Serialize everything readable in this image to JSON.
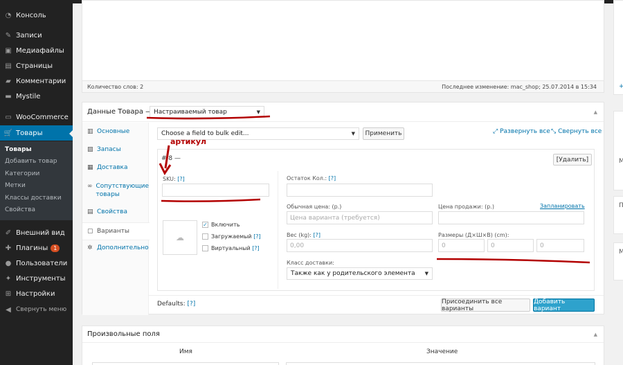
{
  "menu": {
    "items": [
      {
        "label": "Консоль",
        "icon": "dashboard-icon"
      },
      {
        "label": "Записи",
        "icon": "pin-icon"
      },
      {
        "label": "Медиафайлы",
        "icon": "media-icon"
      },
      {
        "label": "Страницы",
        "icon": "pages-icon"
      },
      {
        "label": "Комментарии",
        "icon": "comments-icon"
      },
      {
        "label": "Mystile",
        "icon": "theme-icon"
      },
      {
        "label": "WooCommerce",
        "icon": "woocommerce-icon"
      },
      {
        "label": "Товары",
        "icon": "cart-icon"
      },
      {
        "label": "Внешний вид",
        "icon": "brush-icon"
      },
      {
        "label": "Плагины",
        "icon": "plugin-icon",
        "badge": "1"
      },
      {
        "label": "Пользователи",
        "icon": "users-icon"
      },
      {
        "label": "Инструменты",
        "icon": "wrench-icon"
      },
      {
        "label": "Настройки",
        "icon": "settings-icon"
      },
      {
        "label": "Свернуть меню",
        "icon": "collapse-icon"
      }
    ],
    "submenu": [
      "Товары",
      "Добавить товар",
      "Категории",
      "Метки",
      "Классы доставки",
      "Свойства"
    ]
  },
  "editor": {
    "word_count": "Количество слов: 2",
    "last_edit": "Последнее изменение: mac_shop; 25.07.2014 в 15:34"
  },
  "product_data": {
    "title": "Данные Товара —",
    "type_selected": "Настраиваемый товар",
    "tabs": [
      "Основные",
      "Запасы",
      "Доставка",
      "Сопутствующие товары",
      "Свойства",
      "Варианты",
      "Дополнительно"
    ],
    "bulk_placeholder": "Choose a field to bulk edit...",
    "apply_label": "Применить",
    "expand_all": "Развернуть все",
    "collapse_all": "Свернуть все",
    "variation_title": "#  8 —",
    "remove_label": "[Удалить]",
    "sku_label": "SKU:",
    "help_mark": "[?]",
    "enabled_label": "Включить",
    "downloadable_label": "Загружаемый",
    "virtual_label": "Виртуальный",
    "stock_label": "Остаток Кол.:",
    "regular_price_label": "Обычная цена: (р.)",
    "regular_price_placeholder": "Цена варианта (требуется)",
    "sale_price_label": "Цена продажи: (р.)",
    "schedule_label": "Запланировать",
    "weight_label": "Вес (kg):",
    "weight_placeholder": "0,00",
    "dimensions_label": "Размеры (Д×Ш×В) (cm):",
    "dim_placeholder": "0",
    "shipping_class_label": "Класс доставки:",
    "shipping_class_value": "Также как у родительского элемента",
    "defaults_label": "Defaults:",
    "link_all_label": "Присоединить все варианты",
    "add_variation_label": "Добавить вариант"
  },
  "annotation": {
    "text": "артикул",
    "color": "#b30000"
  },
  "custom_fields": {
    "title": "Произвольные поля",
    "col_name": "Имя",
    "col_value": "Значение"
  },
  "right_sidebar": {
    "link_plus": "+",
    "letter_m": "M",
    "letter_p": "П"
  }
}
